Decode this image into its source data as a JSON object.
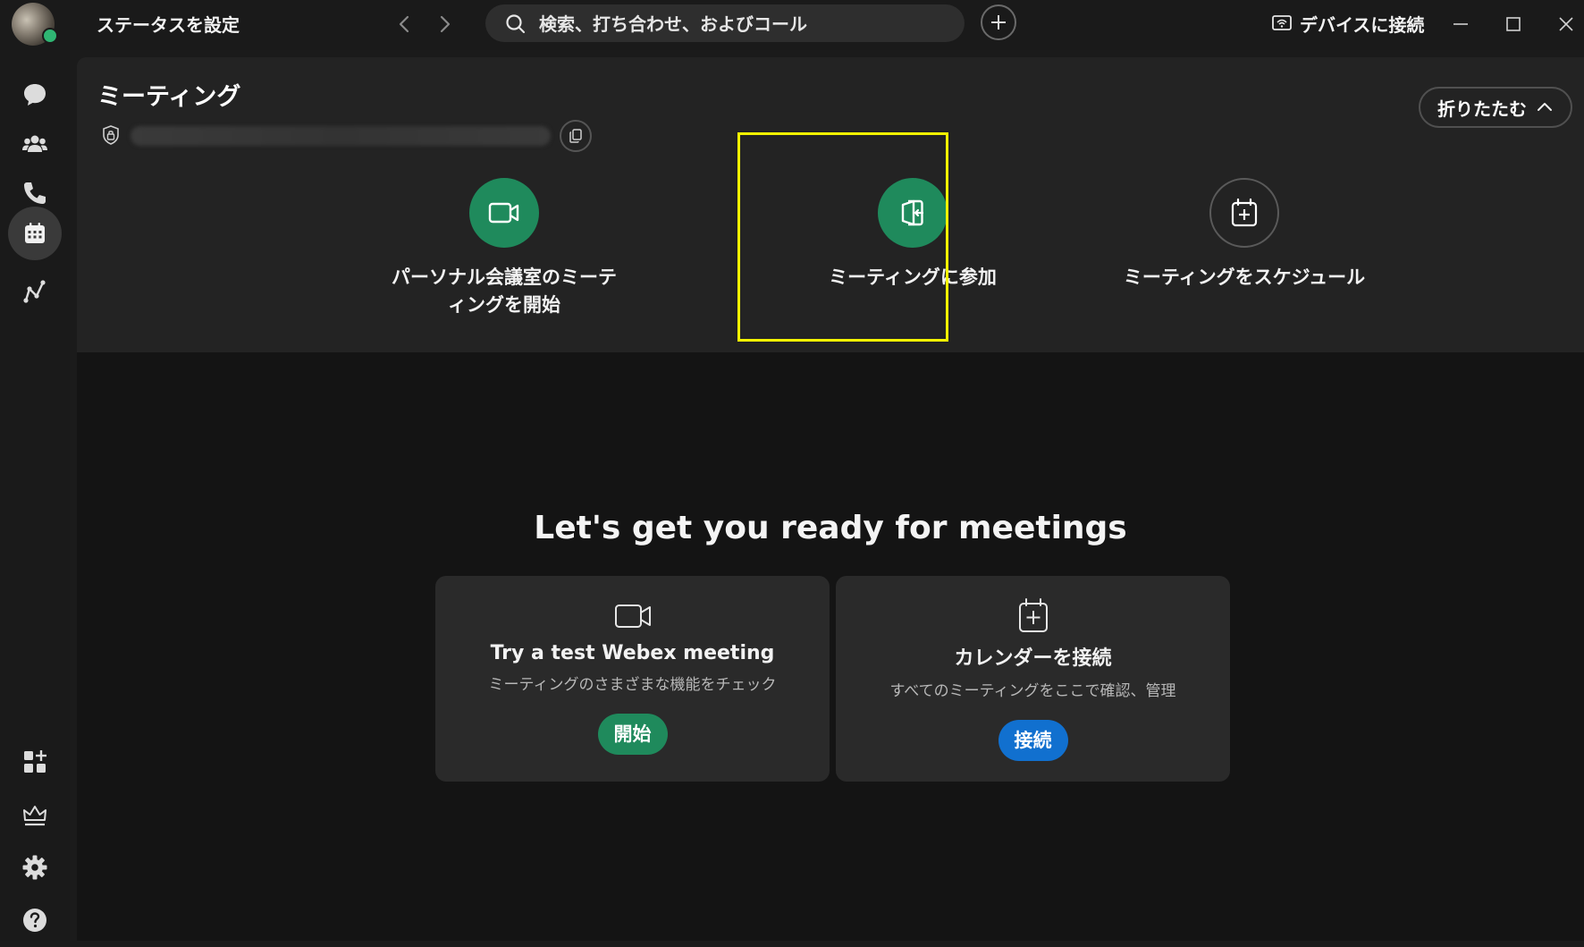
{
  "topbar": {
    "status_label": "ステータスを設定",
    "search_placeholder": "検索、打ち合わせ、およびコール",
    "device_connect_label": "デバイスに接続"
  },
  "rail": {
    "items": [
      "message-icon",
      "teams-icon",
      "phone-icon",
      "calendar-icon",
      "analytics-icon"
    ],
    "bottom_items": [
      "apps-icon",
      "crown-icon",
      "gear-icon",
      "help-icon"
    ],
    "active": "calendar-icon"
  },
  "meetings": {
    "title": "ミーティング",
    "collapse_label": "折りたたむ",
    "actions": [
      {
        "label": "パーソナル会議室のミーティングを開始",
        "icon": "video-camera-icon"
      },
      {
        "label": "ミーティングに参加",
        "icon": "join-meeting-icon"
      },
      {
        "label": "ミーティングをスケジュール",
        "icon": "calendar-add-icon"
      }
    ]
  },
  "ready": {
    "title": "Let's get you ready for meetings",
    "cards": [
      {
        "title": "Try a test Webex meeting",
        "subtitle": "ミーティングのさまざまな機能をチェック",
        "button": "開始",
        "icon": "video-camera-icon"
      },
      {
        "title": "カレンダーを接続",
        "subtitle": "すべてのミーティングをここで確認、管理",
        "button": "接続",
        "icon": "calendar-add-icon"
      }
    ]
  },
  "colors": {
    "accent_green": "#1f8a5c",
    "accent_blue": "#1170cf",
    "highlight": "#f5f500",
    "status_online": "#2fb673"
  }
}
